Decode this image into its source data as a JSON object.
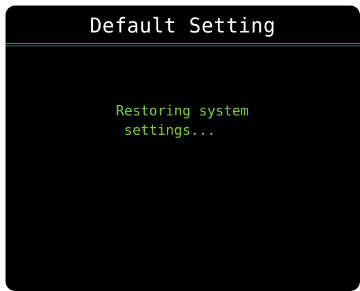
{
  "screen": {
    "title": "Default Setting",
    "message_line1": "Restoring system",
    "message_line2": " settings..."
  },
  "colors": {
    "background": "#000000",
    "title_text": "#ffffff",
    "divider": "#4fb3c9",
    "message_text": "#7cc93c"
  }
}
